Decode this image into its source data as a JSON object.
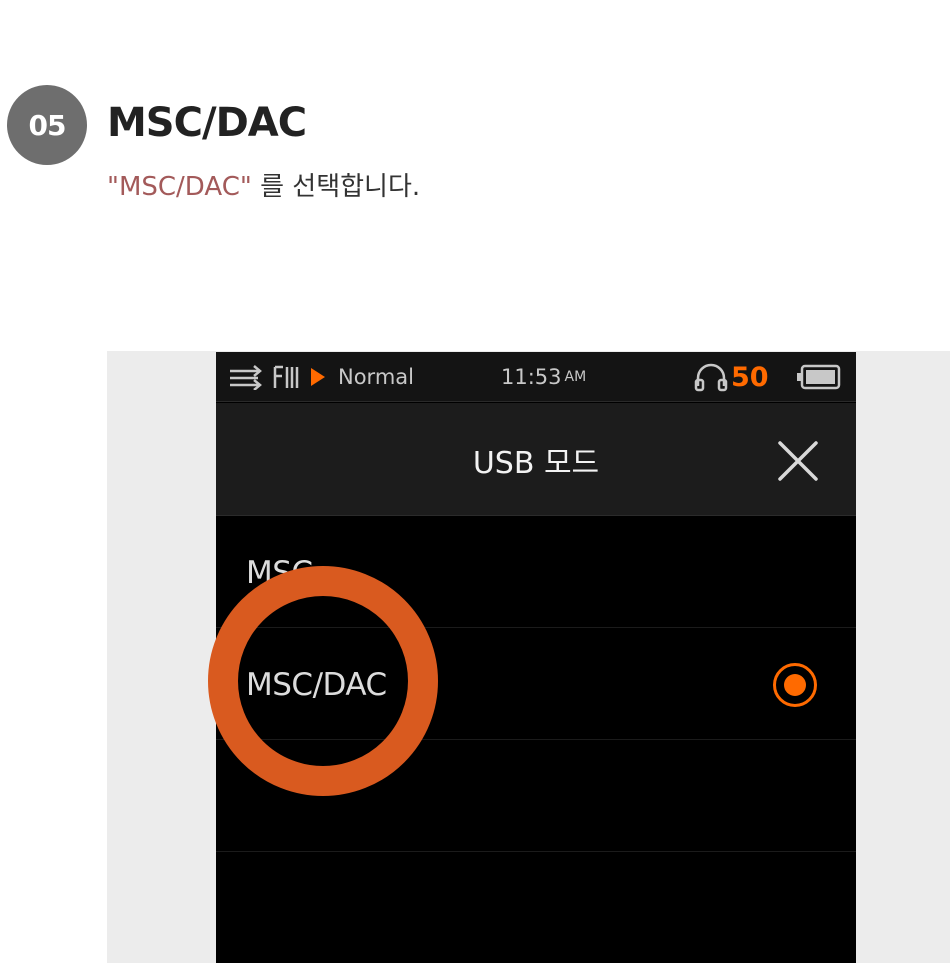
{
  "step": {
    "number": "05",
    "title": "MSC/DAC",
    "desc_highlight": "\"MSC/DAC\"",
    "desc_rest": " 를 선택합니다."
  },
  "device": {
    "status_bar": {
      "icons": [
        "repeat-shuffle-icon",
        "signal-icon",
        "play-icon",
        "headphone-icon",
        "battery-icon"
      ],
      "eq_mode": "Normal",
      "time": "11:53",
      "ampm": "AM",
      "volume": "50"
    },
    "screen_title": "USB 모드",
    "options": [
      {
        "label": "MSC",
        "selected": false
      },
      {
        "label": "MSC/DAC",
        "selected": true
      },
      {
        "label": "",
        "selected": false
      },
      {
        "label": "",
        "selected": false
      }
    ],
    "colors": {
      "accent": "#ff6a00",
      "highlight_ring": "#d95a1f",
      "badge": "#6e6e6e",
      "desc_highlight": "#a35a5a"
    }
  }
}
